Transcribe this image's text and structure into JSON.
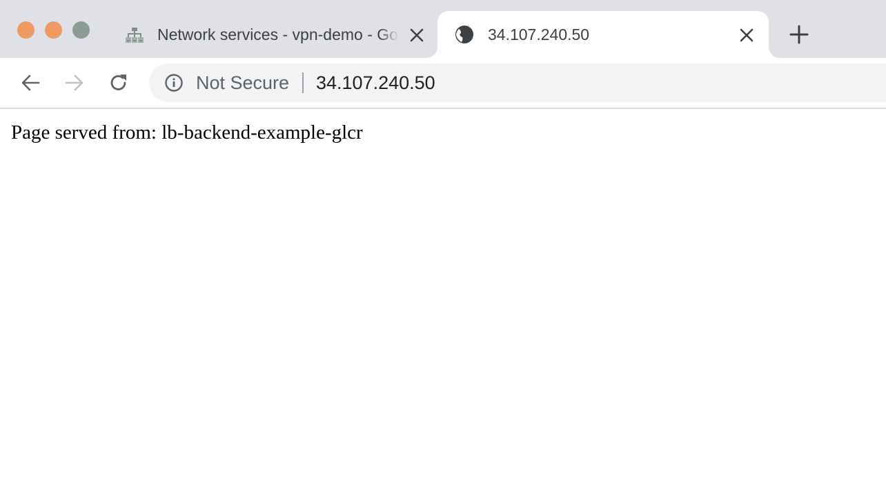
{
  "window": {
    "traffic_lights": {
      "close_color": "#ee9a62",
      "minimize_color": "#ee9a62",
      "maximize_color": "#8c9b93"
    }
  },
  "tabs": [
    {
      "title": "Network services - vpn-demo - Google Cloud",
      "icon": "network-services-icon",
      "active": false
    },
    {
      "title": "34.107.240.50",
      "icon": "globe-icon",
      "active": true
    }
  ],
  "new_tab_icon": "plus-icon",
  "toolbar": {
    "back_icon": "back-arrow-icon",
    "forward_icon": "forward-arrow-icon",
    "reload_icon": "reload-icon"
  },
  "omnibox": {
    "security_icon": "info-icon",
    "security_label": "Not Secure",
    "url": "34.107.240.50"
  },
  "page": {
    "text": "Page served from: lb-backend-example-glcr"
  }
}
